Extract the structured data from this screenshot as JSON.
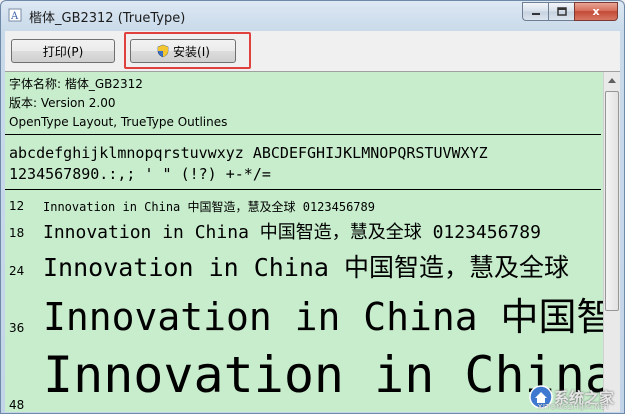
{
  "window": {
    "title": "楷体_GB2312 (TrueType)",
    "close_glyph": "x"
  },
  "toolbar": {
    "print_label": "打印(P)",
    "install_label": "安装(I)"
  },
  "info": {
    "font_name": "字体名称: 楷体_GB2312",
    "version": "版本: Version 2.00",
    "outlines": "OpenType Layout, TrueType Outlines"
  },
  "charset": {
    "line1": "abcdefghijklmnopqrstuvwxyz ABCDEFGHIJKLMNOPQRSTUVWXYZ",
    "line2": "1234567890.:,; ' \" (!?) +-*/="
  },
  "samples": [
    {
      "size": "12",
      "text": "Innovation in China 中国智造，慧及全球 0123456789"
    },
    {
      "size": "18",
      "text": "Innovation in China 中国智造，慧及全球 0123456789"
    },
    {
      "size": "24",
      "text": "Innovation in China 中国智造，慧及全球"
    },
    {
      "size": "36",
      "text": "Innovation in China 中国智造"
    },
    {
      "size": "48",
      "text": "Innovation in China"
    }
  ],
  "watermark": {
    "text": "系统之家",
    "sub": "XITONGZHIJIA.NET"
  },
  "colors": {
    "preview_bg": "#c7edcc",
    "highlight": "#e0413e"
  }
}
